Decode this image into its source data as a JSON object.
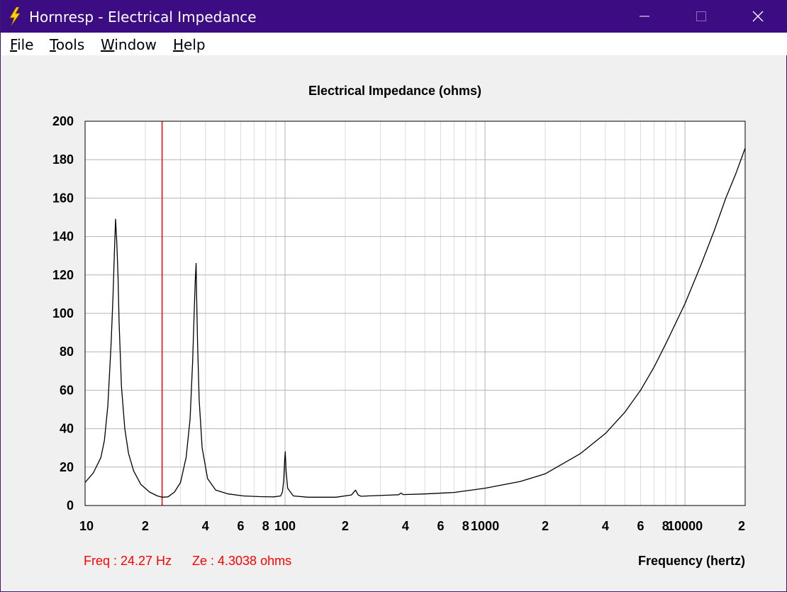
{
  "window": {
    "title": "Hornresp - Electrical Impedance",
    "icon": "lightning-bolt-icon",
    "controls": [
      "minimize-icon",
      "maximize-icon",
      "close-icon"
    ]
  },
  "menu": [
    {
      "accel": "F",
      "rest": "ile"
    },
    {
      "accel": "T",
      "rest": "ools"
    },
    {
      "accel": "W",
      "rest": "indow"
    },
    {
      "accel": "H",
      "rest": "elp"
    }
  ],
  "colors": {
    "titlebar": "#3c0c82",
    "curve": "#000000",
    "cursor": "#ff0000",
    "grid_major": "#b4b4b4",
    "grid_minor": "#dcdcdc"
  },
  "chart_data": {
    "type": "line",
    "title": "Electrical Impedance (ohms)",
    "xlabel": "Frequency (hertz)",
    "ylabel": "",
    "x_scale": "log",
    "xlim": [
      10,
      20000
    ],
    "ylim": [
      0,
      200
    ],
    "y_ticks": [
      0,
      20,
      40,
      60,
      80,
      100,
      120,
      140,
      160,
      180,
      200
    ],
    "x_tick_labels": [
      {
        "value": 10,
        "label": "10"
      },
      {
        "value": 20,
        "label": "2"
      },
      {
        "value": 40,
        "label": "4"
      },
      {
        "value": 60,
        "label": "6"
      },
      {
        "value": 80,
        "label": "8"
      },
      {
        "value": 100,
        "label": "100"
      },
      {
        "value": 200,
        "label": "2"
      },
      {
        "value": 400,
        "label": "4"
      },
      {
        "value": 600,
        "label": "6"
      },
      {
        "value": 800,
        "label": "8"
      },
      {
        "value": 1000,
        "label": "1000"
      },
      {
        "value": 2000,
        "label": "2"
      },
      {
        "value": 4000,
        "label": "4"
      },
      {
        "value": 6000,
        "label": "6"
      },
      {
        "value": 8000,
        "label": "8"
      },
      {
        "value": 10000,
        "label": "10000"
      },
      {
        "value": 20000,
        "label": "2"
      }
    ],
    "grid": true,
    "cursor": {
      "frequency": 24.27,
      "freq_text": "Freq : 24.27 Hz",
      "ze_text": "Ze : 4.3038 ohms"
    },
    "series": [
      {
        "x": [
          10,
          11,
          12,
          12.5,
          13,
          13.5,
          13.8,
          14.0,
          14.2,
          14.4,
          14.6,
          14.8,
          15.2,
          15.8,
          16.5,
          17.5,
          19,
          21,
          23,
          24.27,
          26,
          28,
          30,
          32,
          33.5,
          34.5,
          35.2,
          35.6,
          35.9,
          36.1,
          36.5,
          37.2,
          38.5,
          41,
          45,
          52,
          62,
          75,
          88,
          95,
          97,
          98.5,
          99.5,
          100.2,
          101.2,
          103,
          110,
          130,
          180,
          215,
          225,
          232,
          240,
          260,
          330,
          370,
          380,
          390,
          500,
          700,
          1000,
          1500,
          2000,
          3000,
          4000,
          5000,
          6000,
          7000,
          8000,
          10000,
          12000,
          14000,
          16000,
          18000,
          20000
        ],
        "y": [
          12,
          17,
          25,
          34,
          52,
          85,
          110,
          130,
          149,
          137,
          120,
          95,
          62,
          40,
          27,
          18,
          11,
          7,
          5,
          4.3,
          4.5,
          7,
          12,
          25,
          45,
          75,
          103,
          118,
          126,
          111,
          85,
          55,
          30,
          14,
          8,
          6,
          5,
          4.6,
          4.5,
          5,
          7,
          13,
          23,
          28,
          18,
          9,
          5,
          4.3,
          4.3,
          5.5,
          8,
          5.5,
          4.8,
          5,
          5.4,
          5.6,
          6.5,
          5.7,
          6,
          6.8,
          9,
          12.5,
          16.5,
          27,
          37.5,
          48.5,
          60,
          72,
          84,
          105,
          125,
          143,
          160,
          173,
          186
        ]
      }
    ]
  }
}
